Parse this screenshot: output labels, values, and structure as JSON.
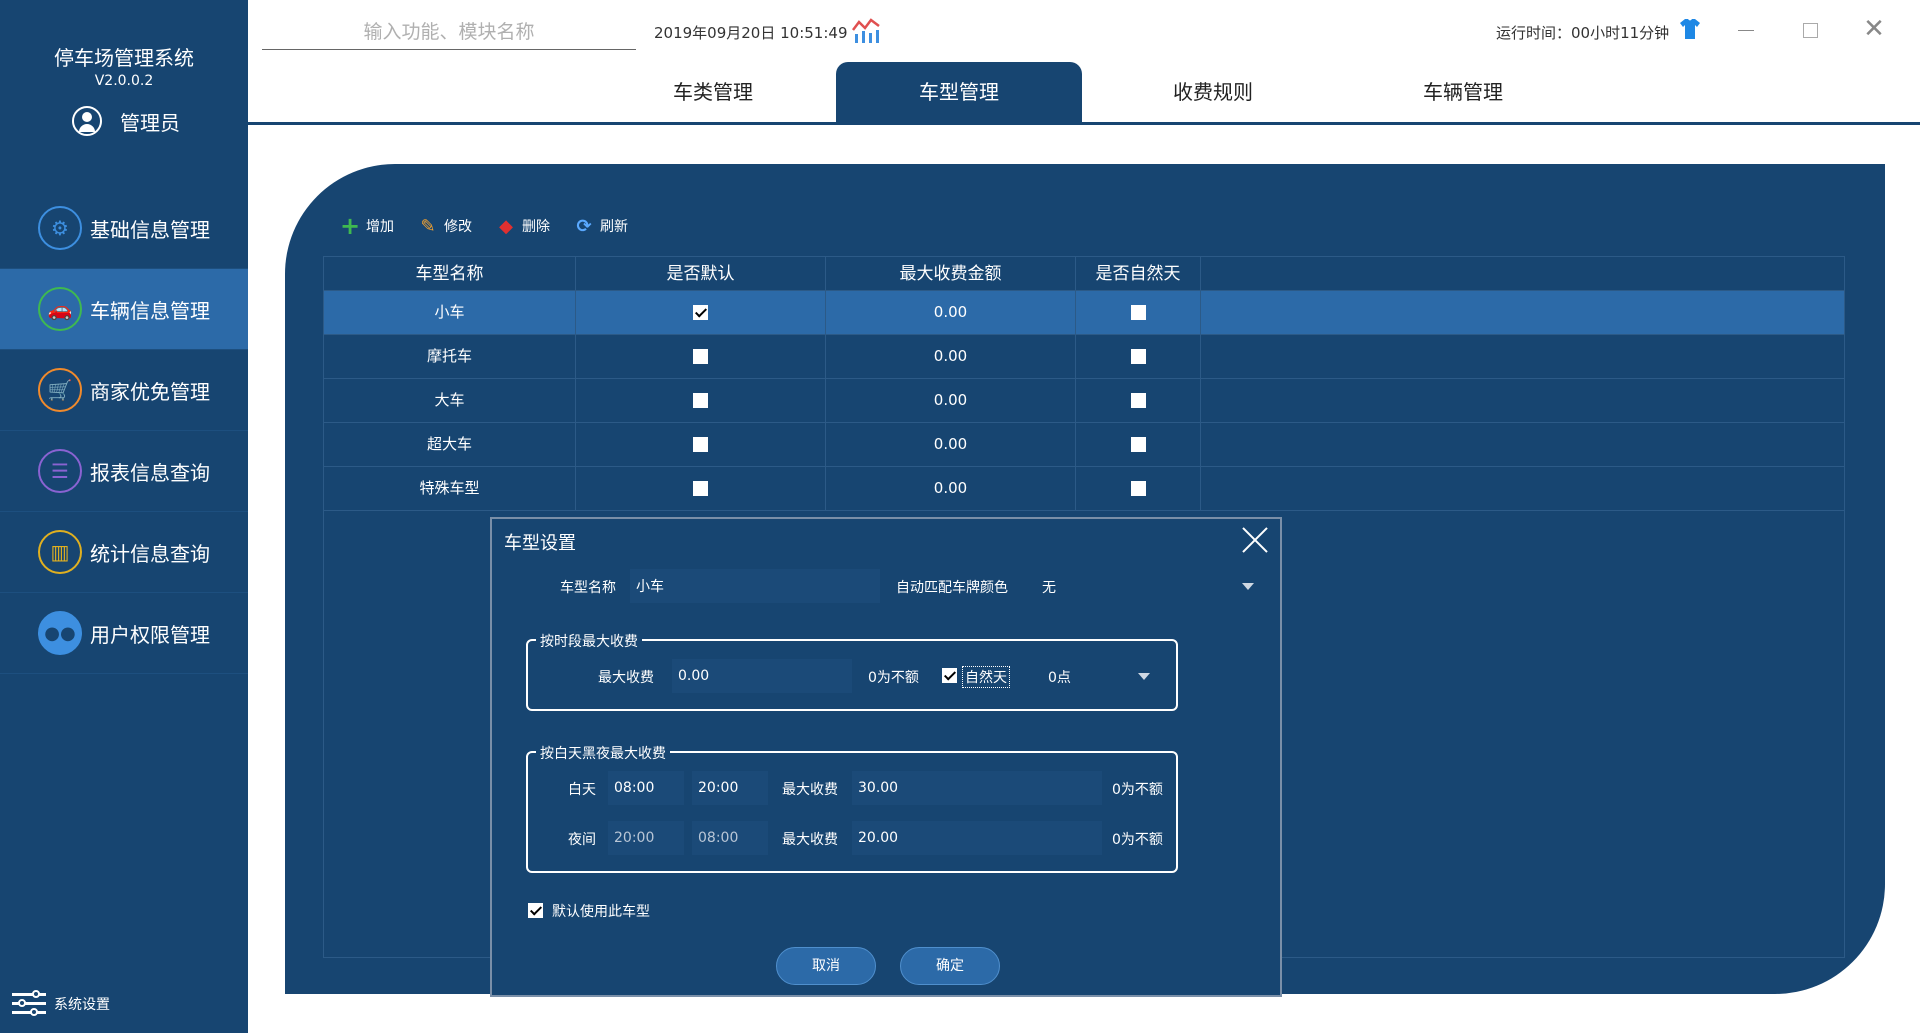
{
  "app": {
    "title": "停车场管理系统",
    "version": "V2.0.0.2",
    "user": "管理员"
  },
  "nav": [
    {
      "label": "基础信息管理",
      "icon": "gear-icon",
      "color": "#3d8fe0"
    },
    {
      "label": "车辆信息管理",
      "icon": "car-icon",
      "color": "#3fb950"
    },
    {
      "label": "商家优免管理",
      "icon": "cart-icon",
      "color": "#f08a2c"
    },
    {
      "label": "报表信息查询",
      "icon": "report-icon",
      "color": "#8a63d2"
    },
    {
      "label": "统计信息查询",
      "icon": "bar-chart-icon",
      "color": "#e0b020"
    },
    {
      "label": "用户权限管理",
      "icon": "users-icon",
      "color": "#3d8fe0"
    }
  ],
  "settings_label": "系统设置",
  "topbar": {
    "search_placeholder": "输入功能、模块名称",
    "datetime": "2019年09月20日 10:51:49",
    "runtime": "运行时间：00小时11分钟"
  },
  "tabs": [
    "车类管理",
    "车型管理",
    "收费规则",
    "车辆管理"
  ],
  "active_tab": 1,
  "toolbar": {
    "add": "增加",
    "edit": "修改",
    "delete": "删除",
    "refresh": "刷新"
  },
  "table": {
    "headers": [
      "车型名称",
      "是否默认",
      "最大收费金额",
      "是否自然天"
    ],
    "rows": [
      {
        "name": "小车",
        "is_default": true,
        "max_fee": "0.00",
        "natural_day": false
      },
      {
        "name": "摩托车",
        "is_default": false,
        "max_fee": "0.00",
        "natural_day": false
      },
      {
        "name": "大车",
        "is_default": false,
        "max_fee": "0.00",
        "natural_day": false
      },
      {
        "name": "超大车",
        "is_default": false,
        "max_fee": "0.00",
        "natural_day": false
      },
      {
        "name": "特殊车型",
        "is_default": false,
        "max_fee": "0.00",
        "natural_day": false
      }
    ]
  },
  "dialog": {
    "title": "车型设置",
    "name_label": "车型名称",
    "name_value": "小车",
    "plate_color_label": "自动匹配车牌颜色",
    "plate_color_value": "无",
    "period_group": {
      "title": "按时段最大收费",
      "max_fee_label": "最大收费",
      "max_fee_value": "0.00",
      "hint": "0为不额",
      "natural_day_label": "自然天",
      "natural_day_checked": true,
      "hour_value": "0点"
    },
    "daynight_group": {
      "title": "按白天黑夜最大收费",
      "day_label": "白天",
      "day_start": "08:00",
      "day_end": "20:00",
      "day_max_label": "最大收费",
      "day_max_value": "30.00",
      "day_hint": "0为不额",
      "night_label": "夜间",
      "night_start": "20:00",
      "night_end": "08:00",
      "night_max_label": "最大收费",
      "night_max_value": "20.00",
      "night_hint": "0为不额"
    },
    "default_label": "默认使用此车型",
    "default_checked": true,
    "cancel": "取消",
    "confirm": "确定"
  }
}
